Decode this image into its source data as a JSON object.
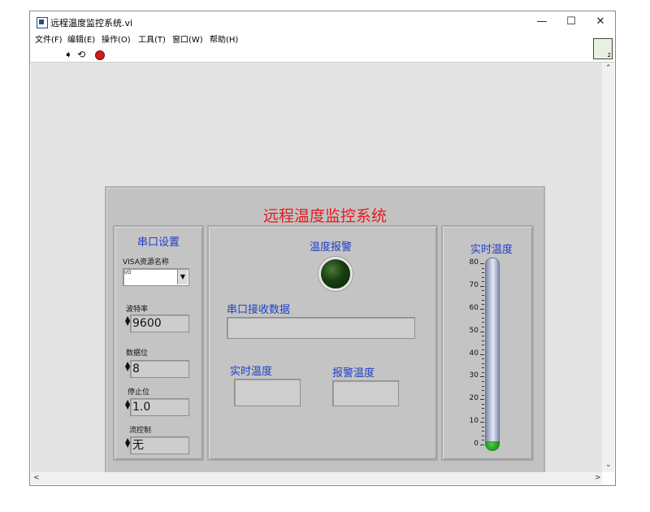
{
  "window": {
    "title": "远程温度监控系统.vi",
    "minimize": "—",
    "maximize": "☐",
    "close": "✕"
  },
  "menu": [
    "文件(F)",
    "编辑(E)",
    "操作(O)",
    "工具(T)",
    "窗口(W)",
    "帮助(H)"
  ],
  "toolbar": {
    "run_icon": "run-arrow-icon",
    "continuous_icon": "run-continuously-icon",
    "abort_icon": "abort-stop-icon"
  },
  "vi_icon_number": "2",
  "panel": {
    "title": "远程温度监控系统",
    "serial": {
      "heading": "串口设置",
      "visa_label": "VISA资源名称",
      "visa_prefix": "I/O",
      "visa_value": "",
      "baud_label": "波特率",
      "baud_value": "9600",
      "databits_label": "数据位",
      "databits_value": "8",
      "stopbits_label": "停止位",
      "stopbits_value": "1.0",
      "flow_label": "流控制",
      "flow_value": "无"
    },
    "main": {
      "alarm_label": "温度报警",
      "alarm_on": false,
      "received_label": "串口接收数据",
      "received_value": "",
      "realtime_label": "实时温度",
      "realtime_value": "",
      "alarm_temp_label": "报警温度",
      "alarm_temp_value": ""
    },
    "thermo": {
      "label": "实时温度",
      "scale": [
        "80",
        "70",
        "60",
        "50",
        "40",
        "30",
        "20",
        "10",
        "0"
      ],
      "value": 0,
      "range": [
        0,
        80
      ]
    }
  },
  "colors": {
    "title_red": "#e8191e",
    "label_blue": "#1f3fc8",
    "led_off": "#173e10",
    "mercury": "#1d8a1d"
  }
}
